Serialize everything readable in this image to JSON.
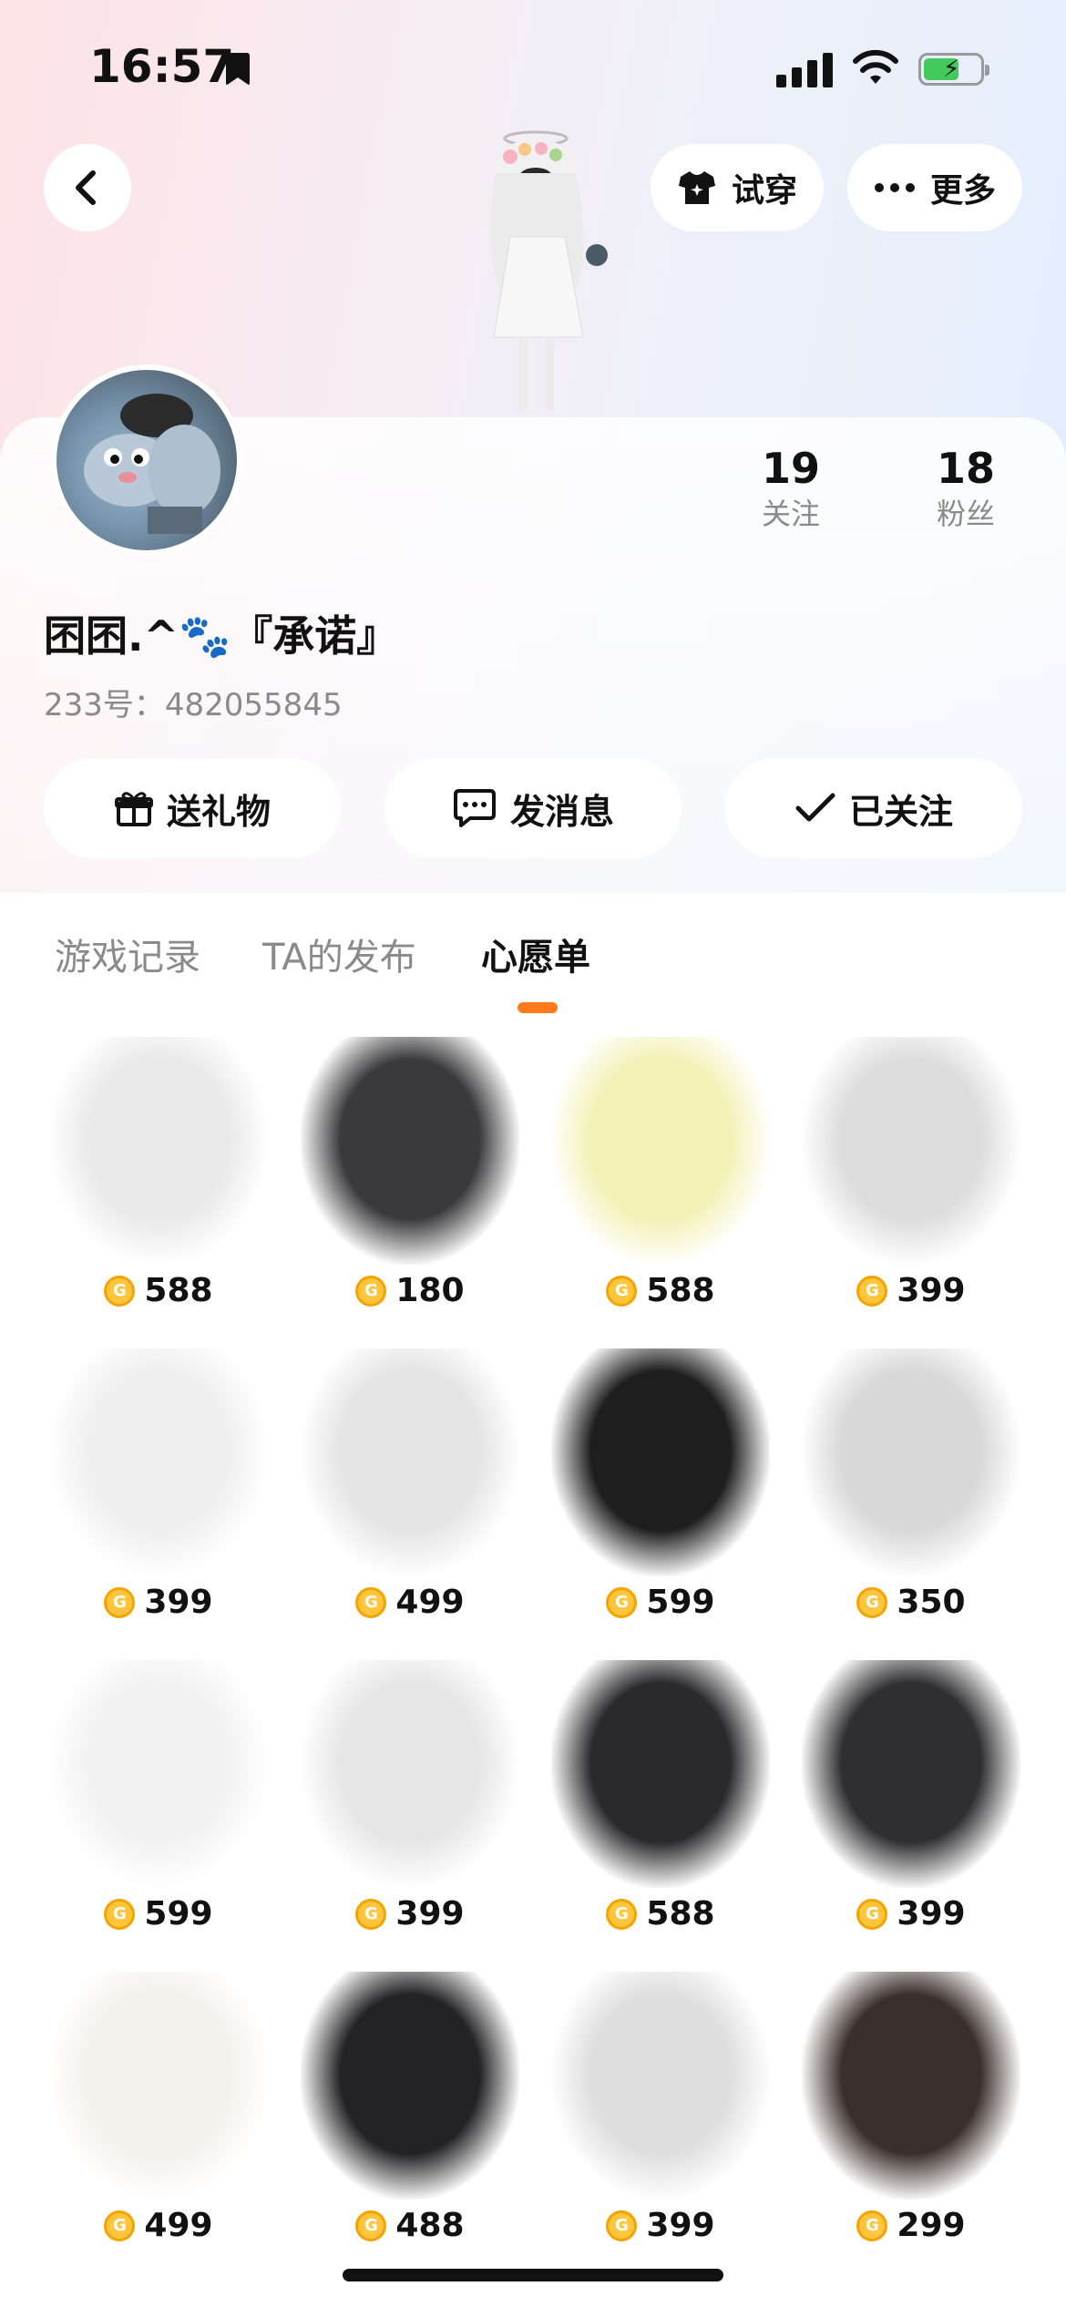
{
  "status_bar": {
    "time": "16:57"
  },
  "header": {
    "try_on_label": "试穿",
    "more_label": "更多"
  },
  "profile": {
    "following_count": "19",
    "following_label": "关注",
    "followers_count": "18",
    "followers_label": "粉丝",
    "username": "囨囨.^🐾『承诺』",
    "uid": "233号：482055845"
  },
  "actions": {
    "gift_label": "送礼物",
    "message_label": "发消息",
    "followed_label": "已关注"
  },
  "tabs": [
    {
      "label": "游戏记录"
    },
    {
      "label": "TA的发布"
    },
    {
      "label": "心愿单"
    }
  ],
  "wishlist": [
    {
      "name": "top-skirt-outfit",
      "price": "588",
      "color": "#e9e9ea"
    },
    {
      "name": "black-wide-pants",
      "price": "180",
      "color": "#3a3a3c"
    },
    {
      "name": "yellow-sailor-dress",
      "price": "588",
      "color": "#f3f1b6"
    },
    {
      "name": "black-white-sneakers",
      "price": "399",
      "color": "#dcdcdc"
    },
    {
      "name": "leg-warmers-slippers",
      "price": "399",
      "color": "#efefef"
    },
    {
      "name": "heart-print-tee-skirt",
      "price": "499",
      "color": "#e4e4e4"
    },
    {
      "name": "black-sweatshirt-dress",
      "price": "599",
      "color": "#1e1e1f"
    },
    {
      "name": "maid-outfit",
      "price": "350",
      "color": "#d8d8d8"
    },
    {
      "name": "white-bow-top-skirt",
      "price": "599",
      "color": "#f2f2f2"
    },
    {
      "name": "white-platform-boots",
      "price": "399",
      "color": "#e6e6e6"
    },
    {
      "name": "black-sailor-dress",
      "price": "588",
      "color": "#2a2a2c"
    },
    {
      "name": "black-mary-janes",
      "price": "399",
      "color": "#2f2f31"
    },
    {
      "name": "white-cat-hoodie",
      "price": "499",
      "color": "#f4f0ec"
    },
    {
      "name": "skeleton-hand-tee",
      "price": "488",
      "color": "#232325"
    },
    {
      "name": "striped-socks-sneakers",
      "price": "399",
      "color": "#dedede"
    },
    {
      "name": "black-pleated-skirt",
      "price": "299",
      "color": "#3b2f2c"
    }
  ]
}
